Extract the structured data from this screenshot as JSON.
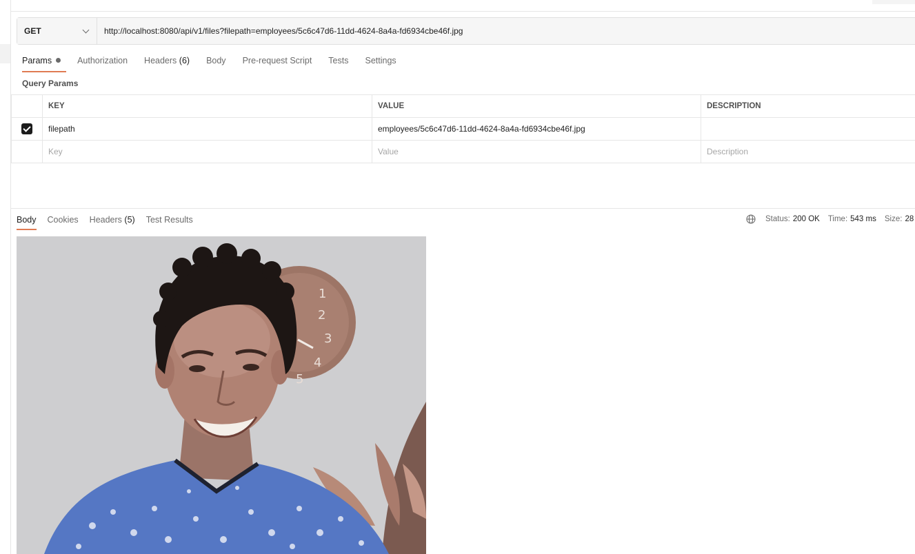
{
  "request": {
    "method": "GET",
    "url": "http://localhost:8080/api/v1/files?filepath=employees/5c6c47d6-11dd-4624-8a4a-fd6934cbe46f.jpg"
  },
  "request_tabs": [
    {
      "label": "Params",
      "active": true
    },
    {
      "label": "Authorization"
    },
    {
      "label": "Headers",
      "count": "(6)"
    },
    {
      "label": "Body"
    },
    {
      "label": "Pre-request Script"
    },
    {
      "label": "Tests"
    },
    {
      "label": "Settings"
    }
  ],
  "query_params": {
    "title": "Query Params",
    "headers": {
      "key": "KEY",
      "value": "VALUE",
      "description": "DESCRIPTION"
    },
    "rows": [
      {
        "checked": true,
        "key": "filepath",
        "value": "employees/5c6c47d6-11dd-4624-8a4a-fd6934cbe46f.jpg",
        "description": ""
      }
    ],
    "placeholders": {
      "key": "Key",
      "value": "Value",
      "description": "Description"
    }
  },
  "response_tabs": [
    {
      "label": "Body",
      "active": true
    },
    {
      "label": "Cookies"
    },
    {
      "label": "Headers",
      "count": "(5)"
    },
    {
      "label": "Test Results"
    }
  ],
  "response_meta": {
    "status_label": "Status:",
    "status_value": "200 OK",
    "time_label": "Time:",
    "time_value": "543 ms",
    "size_label": "Size:",
    "size_value": "28"
  },
  "colors": {
    "accent": "#e07b53"
  },
  "icons": {
    "globe": "globe-icon",
    "chevron": "chevron-down-icon",
    "checkbox": "checkbox-checked-icon"
  }
}
